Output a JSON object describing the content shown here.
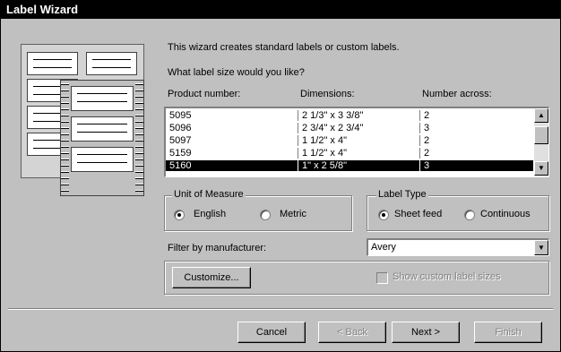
{
  "window": {
    "title": "Label Wizard"
  },
  "intro": {
    "line1": "This wizard creates standard labels or custom labels.",
    "question": "What label size would you like?"
  },
  "table": {
    "headers": [
      "Product number:",
      "Dimensions:",
      "Number across:"
    ],
    "rows": [
      {
        "product": "5095",
        "dimensions": "2 1/3\" x 3 3/8\"",
        "across": "2"
      },
      {
        "product": "5096",
        "dimensions": "2 3/4\" x 2 3/4\"",
        "across": "3"
      },
      {
        "product": "5097",
        "dimensions": "1 1/2\" x 4\"",
        "across": "2"
      },
      {
        "product": "5159",
        "dimensions": "1 1/2\" x 4\"",
        "across": "2"
      },
      {
        "product": "5160",
        "dimensions": "1\" x 2 5/8\"",
        "across": "3"
      }
    ],
    "selected_index": 4
  },
  "unit_of_measure": {
    "legend": "Unit of Measure",
    "options": [
      "English",
      "Metric"
    ],
    "selected": "English"
  },
  "label_type": {
    "legend": "Label Type",
    "options": [
      "Sheet feed",
      "Continuous"
    ],
    "selected": "Sheet feed"
  },
  "filter": {
    "label": "Filter by manufacturer:",
    "value": "Avery"
  },
  "customize": {
    "button": "Customize...",
    "show_custom_label": "Show custom label sizes"
  },
  "footer": {
    "cancel": "Cancel",
    "back": "< Back",
    "next": "Next >",
    "finish": "Finish"
  },
  "icons": {
    "scroll_up": "scroll-up-arrow-icon",
    "scroll_down": "scroll-down-arrow-icon",
    "dropdown": "dropdown-arrow-icon",
    "illustration": "label-sheets-illustration"
  }
}
